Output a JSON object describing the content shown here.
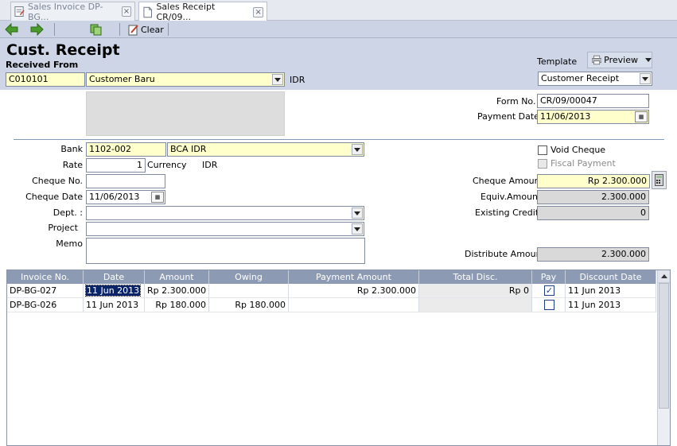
{
  "tabs": [
    {
      "label": "Sales Invoice DP-BG...",
      "icon": "invoice-icon",
      "active": false
    },
    {
      "label": "Sales Receipt CR/09...",
      "icon": "document-icon",
      "active": true
    }
  ],
  "toolbar": {
    "clear_label": "Clear"
  },
  "header": {
    "title": "Cust. Receipt",
    "received_from_label": "Received From",
    "customer_code": "C010101",
    "customer_name": "Customer Baru",
    "currency_code": "IDR",
    "template_label": "Template",
    "preview_label": "Preview",
    "template_value": "Customer Receipt"
  },
  "info": {
    "form_no_label": "Form No.",
    "form_no": "CR/09/00047",
    "payment_date_label": "Payment Date",
    "payment_date": "11/06/2013"
  },
  "details": {
    "bank_label": "Bank",
    "bank_code": "1102-002",
    "bank_name": "BCA IDR",
    "rate_label": "Rate",
    "rate": "1",
    "currency_label": "Currency",
    "currency": "IDR",
    "cheque_no_label": "Cheque No.",
    "cheque_no": "",
    "cheque_date_label": "Cheque Date",
    "cheque_date": "11/06/2013",
    "dept_label": "Dept. :",
    "dept": "",
    "project_label": "Project",
    "project": "",
    "memo_label": "Memo",
    "memo": ""
  },
  "amounts": {
    "void_cheque_label": "Void Cheque",
    "fiscal_payment_label": "Fiscal Payment",
    "cheque_amount_label": "Cheque Amount",
    "cheque_amount": "Rp 2.300.000",
    "equiv_amount_label": "Equiv.Amount",
    "equiv_amount": "2.300.000",
    "existing_credits_label": "Existing Credits",
    "existing_credits": "0",
    "distribute_amount_label": "Distribute Amount",
    "distribute_amount": "2.300.000"
  },
  "grid": {
    "columns": [
      "Invoice No.",
      "Date",
      "Amount",
      "Owing",
      "Payment Amount",
      "Total Disc.",
      "Pay",
      "Discount Date"
    ],
    "rows": [
      {
        "invoice": "DP-BG-027",
        "date": "11 Jun 2013",
        "amount": "Rp 2.300.000",
        "owing": "",
        "payment": "Rp 2.300.000",
        "disc": "Rp 0",
        "pay": true,
        "disc_date": "11 Jun 2013"
      },
      {
        "invoice": "DP-BG-026",
        "date": "11 Jun 2013",
        "amount": "Rp 180.000",
        "owing": "Rp 180.000",
        "payment": "",
        "disc": "",
        "pay": false,
        "disc_date": "11 Jun 2013"
      }
    ]
  },
  "colors": {
    "header_bg": "#cdd5e6",
    "field_yellow": "#ffffcc",
    "grid_header": "#8d9ab3"
  }
}
